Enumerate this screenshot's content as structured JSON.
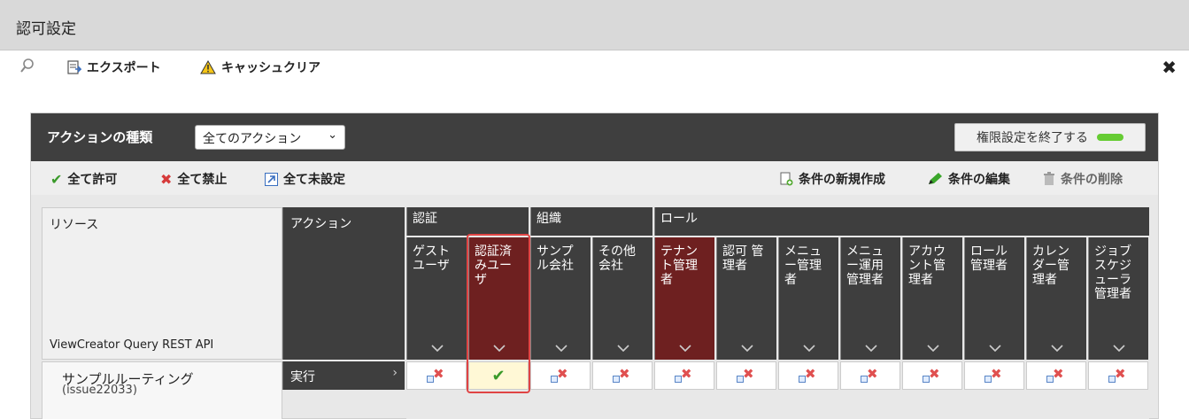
{
  "window": {
    "title": "認可設定"
  },
  "toolbar": {
    "search_icon": "search-icon",
    "export_label": "エクスポート",
    "cache_clear_label": "キャッシュクリア"
  },
  "panel": {
    "action_type_label": "アクションの種類",
    "action_type_value": "全てのアクション",
    "finish_button": "権限設定を終了する"
  },
  "actions": {
    "allow_all": "全て許可",
    "deny_all": "全て禁止",
    "unset_all": "全て未設定",
    "new_condition": "条件の新規作成",
    "edit_condition": "条件の編集",
    "delete_condition": "条件の削除"
  },
  "grid": {
    "resource_header": "リソース",
    "action_header": "アクション",
    "group_auth": "認証",
    "group_org": "組織",
    "group_role": "ロール",
    "resource_name": "ViewCreator Query REST API",
    "row_resource": "サンプルルーティング",
    "row_resource_sub": "(issue22033)",
    "row_action": "実行",
    "columns": [
      {
        "label": "ゲストユーザ",
        "lines": [
          "ゲスト",
          "ユーザ"
        ]
      },
      {
        "label": "認証済みユーザ",
        "lines": [
          "認証済",
          "みユー",
          "ザ"
        ]
      },
      {
        "label": "サンプル会社",
        "lines": [
          "サンプ",
          "ル会社"
        ]
      },
      {
        "label": "その他会社",
        "lines": [
          "その他",
          "会社"
        ]
      },
      {
        "label": "テナント管理者",
        "lines": [
          "テナン",
          "ト管理",
          "者"
        ]
      },
      {
        "label": "認可管理者",
        "lines": [
          "認可 管",
          "理者"
        ]
      },
      {
        "label": "メニュー管理者",
        "lines": [
          "メニュ",
          "ー管理",
          "者"
        ]
      },
      {
        "label": "メニュー運用管理者",
        "lines": [
          "メニュ",
          "ー運用",
          "管理者"
        ]
      },
      {
        "label": "アカウント管理者",
        "lines": [
          "アカウ",
          "ント管",
          "理者"
        ]
      },
      {
        "label": "ロール管理者",
        "lines": [
          "ロール",
          "管理者"
        ]
      },
      {
        "label": "カレンダー管理者",
        "lines": [
          "カレン",
          "ダー管",
          "理者"
        ]
      },
      {
        "label": "ジョブスケジューラ管理者",
        "lines": [
          "ジョブ",
          "スケジ",
          "ューラ",
          "管理者"
        ]
      }
    ],
    "row_values": [
      "deny",
      "allow",
      "deny",
      "deny",
      "deny",
      "deny",
      "deny",
      "deny",
      "deny",
      "deny",
      "deny",
      "deny"
    ]
  },
  "colors": {
    "accent_green": "#66cc33",
    "header_dark": "#3e3e3e",
    "selected_red": "#6e2020",
    "highlight": "#e04444"
  }
}
